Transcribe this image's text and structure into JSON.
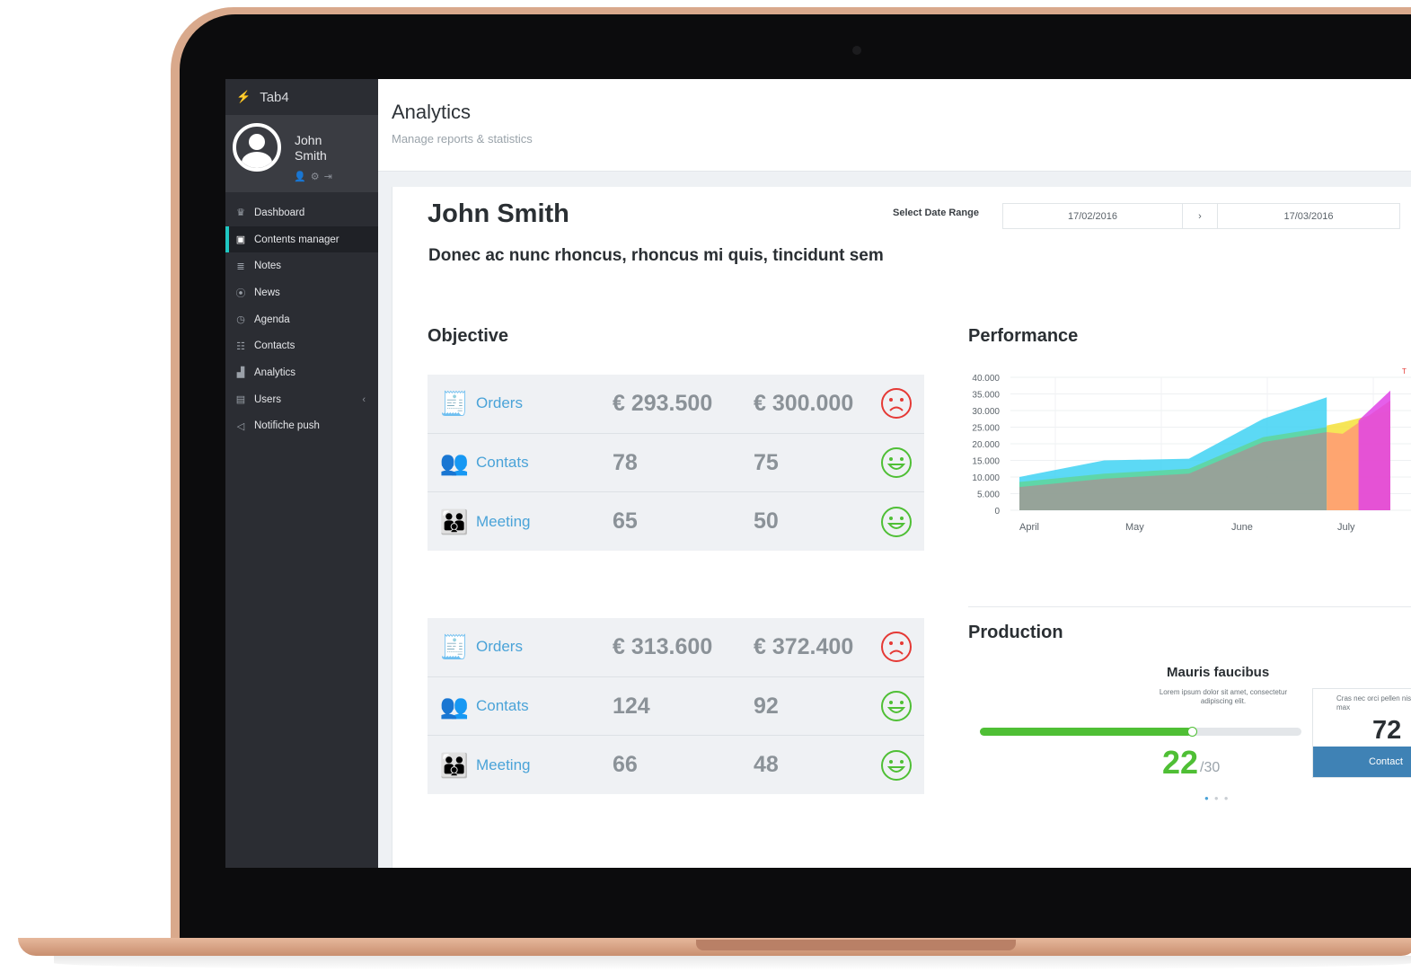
{
  "app": {
    "title": "Tab4"
  },
  "user": {
    "first": "John",
    "last": "Smith"
  },
  "sidebar": {
    "items": [
      {
        "label": "Dashboard",
        "icon": "trophy-icon"
      },
      {
        "label": "Contents manager",
        "icon": "film-icon"
      },
      {
        "label": "Notes",
        "icon": "notes-icon"
      },
      {
        "label": "News",
        "icon": "broadcast-icon"
      },
      {
        "label": "Agenda",
        "icon": "clock-icon"
      },
      {
        "label": "Contacts",
        "icon": "group-icon"
      },
      {
        "label": "Analytics",
        "icon": "bar-chart-icon"
      },
      {
        "label": "Users",
        "icon": "table-icon"
      },
      {
        "label": "Notifiche push",
        "icon": "megaphone-icon"
      }
    ],
    "active": "Contents manager"
  },
  "header": {
    "title": "Analytics",
    "subtitle": "Manage reports & statistics"
  },
  "report": {
    "name": "John Smith",
    "tagline": "Donec ac nunc rhoncus, rhoncus mi quis, tincidunt sem",
    "date_range_label": "Select Date Range",
    "date_from": "17/02/2016",
    "date_sep": "›",
    "date_to": "17/03/2016"
  },
  "objective": {
    "title": "Objective",
    "tables": [
      [
        {
          "label": "Orders",
          "value": "€ 293.500",
          "target": "€ 300.000",
          "mood": "sad"
        },
        {
          "label": "Contats",
          "value": "78",
          "target": "75",
          "mood": "happy"
        },
        {
          "label": "Meeting",
          "value": "65",
          "target": "50",
          "mood": "happy"
        }
      ],
      [
        {
          "label": "Orders",
          "value": "€ 313.600",
          "target": "€ 372.400",
          "mood": "sad"
        },
        {
          "label": "Contats",
          "value": "124",
          "target": "92",
          "mood": "happy"
        },
        {
          "label": "Meeting",
          "value": "66",
          "target": "48",
          "mood": "happy"
        }
      ]
    ]
  },
  "performance": {
    "title": "Performance"
  },
  "chart_data": {
    "type": "area",
    "title": "Performance",
    "x": [
      "April",
      "May",
      "June",
      "July"
    ],
    "yticks": [
      "40.000",
      "35.000",
      "30.000",
      "25.000",
      "20.000",
      "15.000",
      "10.000",
      "5.000",
      "0"
    ],
    "ylim": [
      0,
      40000
    ],
    "grid": true,
    "series": [
      {
        "color": "#40d2f3",
        "points": [
          [
            0,
            10000
          ],
          [
            0.8,
            15000
          ],
          [
            1.6,
            15500
          ],
          [
            2.3,
            27500
          ],
          [
            2.9,
            34000
          ]
        ]
      },
      {
        "color": "#5fd59a",
        "points": [
          [
            0,
            8500
          ],
          [
            0.8,
            11000
          ],
          [
            1.6,
            12500
          ],
          [
            2.3,
            22000
          ],
          [
            2.9,
            25000
          ]
        ]
      },
      {
        "color": "#c27a8c",
        "points": [
          [
            0,
            7000
          ],
          [
            0.8,
            9500
          ],
          [
            1.6,
            11000
          ],
          [
            2.3,
            20500
          ],
          [
            2.9,
            23500
          ]
        ]
      },
      {
        "color": "#f5e13a",
        "points": [
          [
            2.9,
            25500
          ],
          [
            3.05,
            26500
          ],
          [
            3.5,
            30000
          ]
        ]
      },
      {
        "color": "#ff9a74",
        "points": [
          [
            2.9,
            23500
          ],
          [
            3.05,
            23000
          ],
          [
            3.5,
            33000
          ]
        ]
      },
      {
        "color": "#e043e6",
        "points": [
          [
            3.2,
            27000
          ],
          [
            3.5,
            36000
          ]
        ]
      }
    ],
    "legend_fragment": "T"
  },
  "production": {
    "title": "Production",
    "card_title": "Mauris faucibus",
    "card_desc": "Lorem ipsum dolor sit amet, consectetur adipiscing elit.",
    "progress": 0.66,
    "score": "22",
    "score_of": "/30",
    "card2_desc": "Cras nec orci pellen nisi volutpat max",
    "card2_value": "72",
    "card2_button": "Contact"
  },
  "colors": {
    "accent": "#1fc7c2",
    "link": "#4aa3d8",
    "success": "#4fbf35",
    "danger": "#e53935",
    "button": "#3f82b5"
  }
}
